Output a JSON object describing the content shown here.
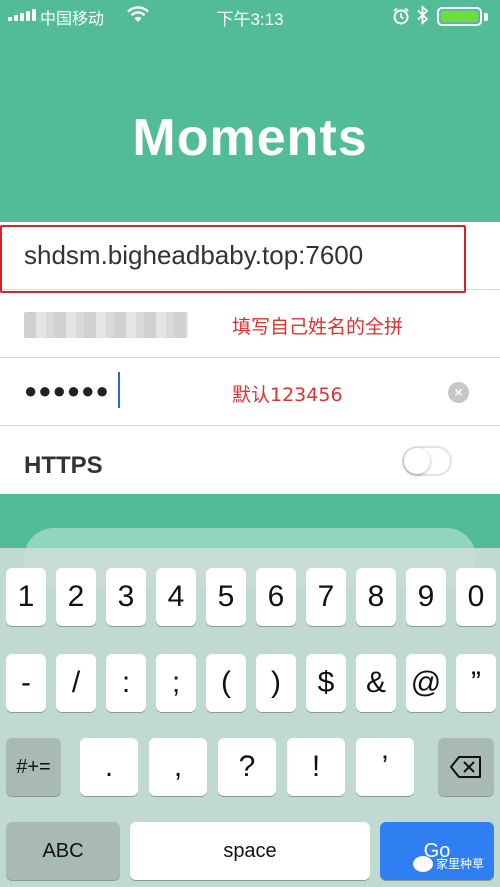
{
  "status_bar": {
    "carrier": "中国移动",
    "time": "下午3:13",
    "icons": [
      "signal-icon",
      "wifi-icon",
      "alarm-icon",
      "bluetooth-icon",
      "battery-icon"
    ],
    "battery_color": "#6fdc3c"
  },
  "app": {
    "title": "Moments",
    "background_color": "#52bc97"
  },
  "form": {
    "server_value": "shdsm.bigheadbaby.top:7600",
    "username_note": "填写自己姓名的全拼",
    "password_value": "●●●●●●",
    "password_note": "默认123456",
    "https_label": "HTTPS",
    "https_enabled": false,
    "annotation_color": "#e02020"
  },
  "keyboard": {
    "row1": [
      "1",
      "2",
      "3",
      "4",
      "5",
      "6",
      "7",
      "8",
      "9",
      "0"
    ],
    "row2": [
      "-",
      "/",
      ":",
      ";",
      "(",
      ")",
      "$",
      "&",
      "@",
      "”"
    ],
    "row3_shift": "#+=",
    "row3": [
      ".",
      ",",
      "?",
      "!",
      "’"
    ],
    "abc_label": "ABC",
    "space_label": "space",
    "go_label": "Go",
    "go_color": "#2f7ff2"
  },
  "watermark": {
    "text": "家里种草"
  }
}
